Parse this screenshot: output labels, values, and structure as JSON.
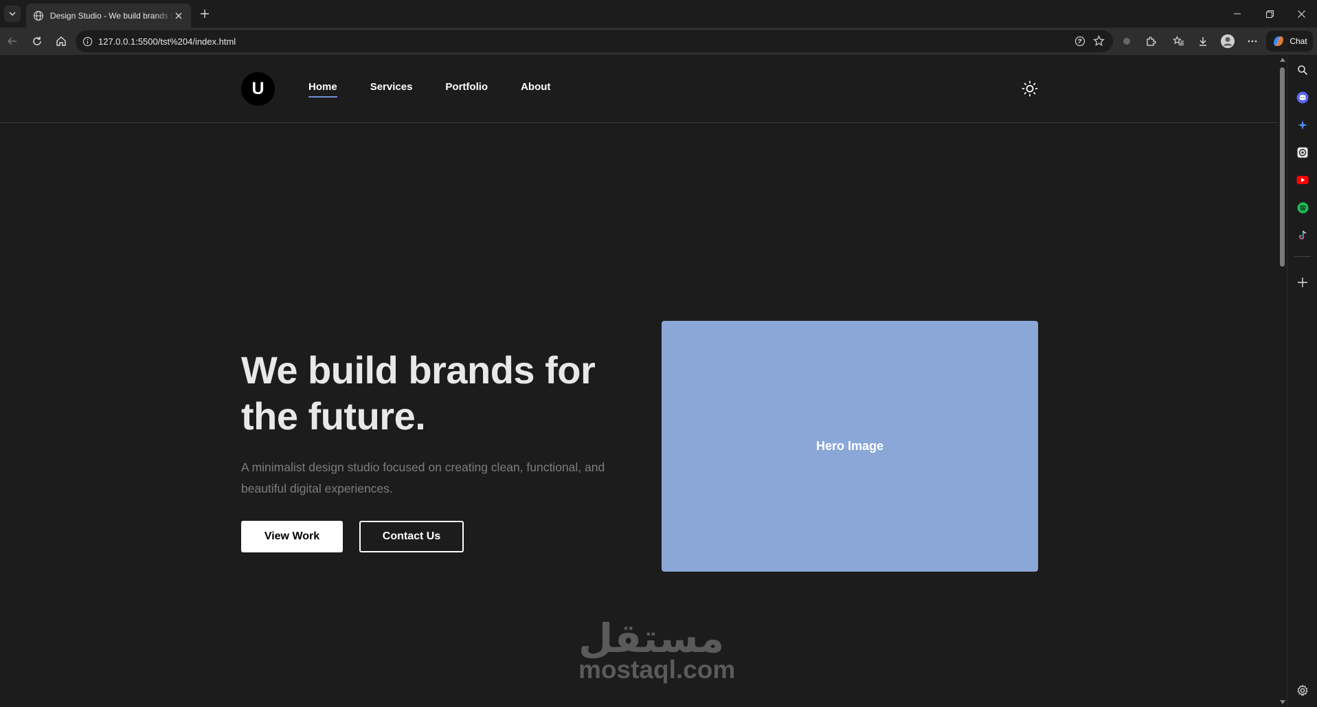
{
  "browser": {
    "tab": {
      "title": "Design Studio - We build brands for the future"
    },
    "address_bar": {
      "url": "127.0.0.1:5500/tst%204/index.html"
    },
    "chat_label": "Chat"
  },
  "site": {
    "logo_letter": "U",
    "nav": [
      {
        "label": "Home",
        "active": true
      },
      {
        "label": "Services",
        "active": false
      },
      {
        "label": "Portfolio",
        "active": false
      },
      {
        "label": "About",
        "active": false
      }
    ],
    "hero": {
      "title": "We build brands for the future.",
      "subtitle": "A minimalist design studio focused on creating clean, functional, and beautiful digital experiences.",
      "primary_button": "View Work",
      "secondary_button": "Contact Us",
      "image_label": "Hero Image"
    }
  },
  "watermark": {
    "arabic": "مستقل",
    "latin": "mostaql.com"
  },
  "colors": {
    "page_bg": "#1c1c1c",
    "toolbar_bg": "#2e2e2e",
    "accent_underline": "#6f8fd6",
    "hero_image_bg": "#8aa7d8",
    "subtitle_text": "#7d7d7d"
  },
  "icons": {
    "sidebar": [
      "search-icon",
      "discord-icon",
      "copilot-icon",
      "chatgpt-icon",
      "youtube-icon",
      "spotify-icon",
      "tiktok-icon",
      "add-icon",
      "settings-icon"
    ]
  }
}
